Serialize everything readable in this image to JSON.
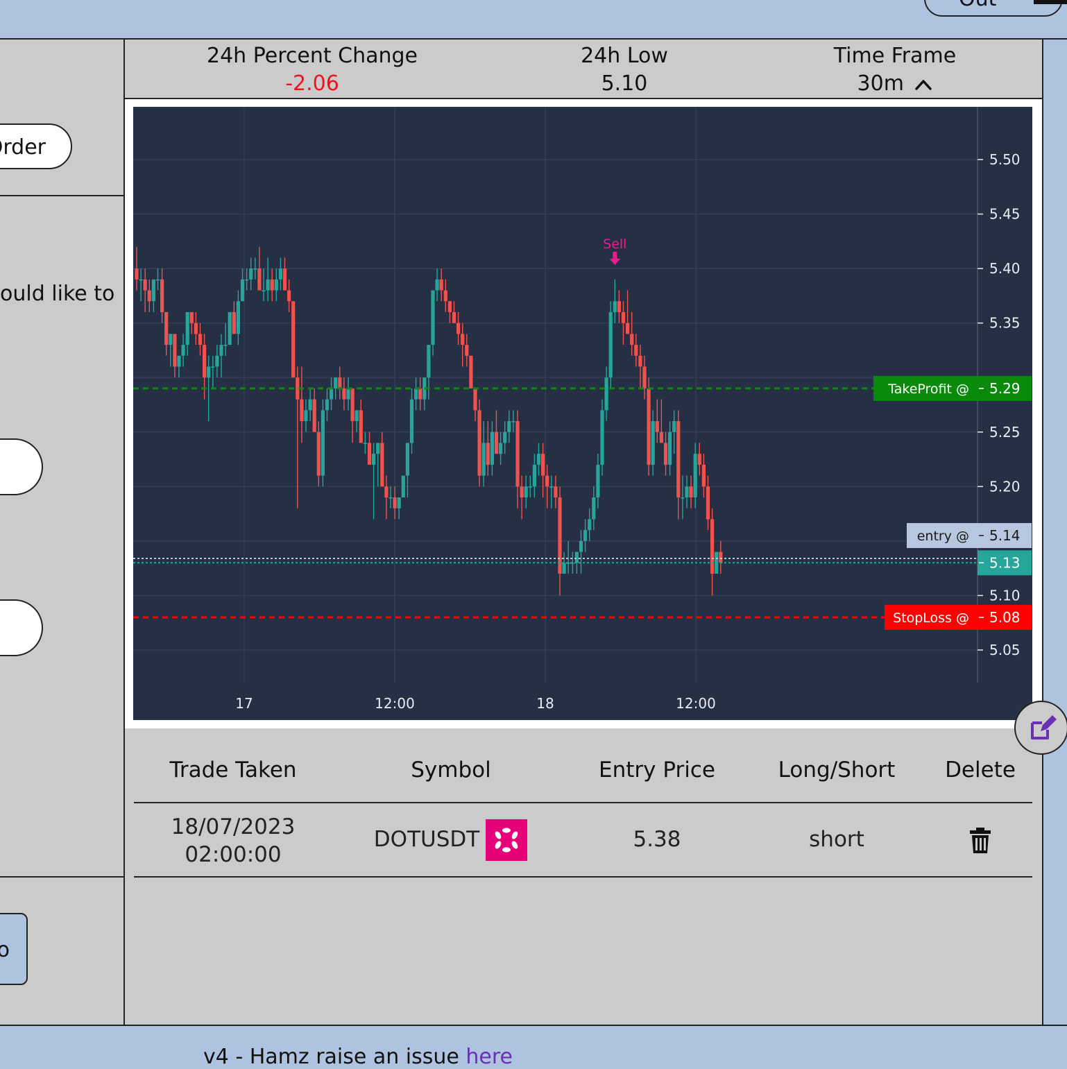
{
  "topbar": {
    "logout_label": "Out"
  },
  "left": {
    "order_label": "Order",
    "prompt_text": "ould like to",
    "bottom_button_label": "o"
  },
  "stats": {
    "percent_change_label": "24h Percent Change",
    "percent_change_value": "-2.06",
    "low_label": "24h Low",
    "low_value": "5.10",
    "timeframe_label": "Time Frame",
    "timeframe_value": "30m",
    "negative_color": "#f0141e"
  },
  "chart_data": {
    "type": "candlestick",
    "x_ticks": [
      "17",
      "12:00",
      "18",
      "12:00"
    ],
    "y_ticks": [
      "5.50",
      "5.45",
      "5.40",
      "5.35",
      "5.25",
      "5.20",
      "5.10",
      "5.05"
    ],
    "ylim": [
      5.03,
      5.55
    ],
    "grid": true,
    "up_color": "#26a69a",
    "down_color": "#ef5350",
    "markers": [
      {
        "label": "Sell",
        "color": "#e91e8c",
        "candle_index": 113
      }
    ],
    "price_lines": [
      {
        "label": "TakeProfit @",
        "value": "5.29",
        "color": "#0a8a0a"
      },
      {
        "label": "entry @",
        "value": "5.14",
        "color": "#b8c7e0"
      },
      {
        "label": "",
        "value": "5.13",
        "color": "#26a69a"
      },
      {
        "label": "StopLoss @",
        "value": "5.08",
        "color": "#ff0000"
      }
    ],
    "last_price": 5.13,
    "candles": [
      [
        5.4,
        5.42,
        5.38,
        5.39
      ],
      [
        5.39,
        5.4,
        5.37,
        5.39
      ],
      [
        5.39,
        5.4,
        5.36,
        5.38
      ],
      [
        5.38,
        5.39,
        5.36,
        5.37
      ],
      [
        5.37,
        5.39,
        5.36,
        5.39
      ],
      [
        5.39,
        5.4,
        5.38,
        5.39
      ],
      [
        5.39,
        5.4,
        5.35,
        5.36
      ],
      [
        5.36,
        5.36,
        5.32,
        5.33
      ],
      [
        5.33,
        5.34,
        5.31,
        5.34
      ],
      [
        5.34,
        5.34,
        5.3,
        5.31
      ],
      [
        5.31,
        5.32,
        5.3,
        5.32
      ],
      [
        5.32,
        5.34,
        5.31,
        5.33
      ],
      [
        5.33,
        5.36,
        5.32,
        5.36
      ],
      [
        5.36,
        5.36,
        5.34,
        5.35
      ],
      [
        5.35,
        5.36,
        5.33,
        5.34
      ],
      [
        5.34,
        5.35,
        5.32,
        5.33
      ],
      [
        5.33,
        5.34,
        5.28,
        5.3
      ],
      [
        5.3,
        5.32,
        5.26,
        5.31
      ],
      [
        5.31,
        5.32,
        5.29,
        5.31
      ],
      [
        5.31,
        5.33,
        5.3,
        5.32
      ],
      [
        5.32,
        5.34,
        5.3,
        5.33
      ],
      [
        5.33,
        5.35,
        5.32,
        5.33
      ],
      [
        5.33,
        5.36,
        5.33,
        5.36
      ],
      [
        5.36,
        5.37,
        5.34,
        5.34
      ],
      [
        5.34,
        5.38,
        5.33,
        5.37
      ],
      [
        5.37,
        5.4,
        5.37,
        5.39
      ],
      [
        5.39,
        5.4,
        5.38,
        5.39
      ],
      [
        5.39,
        5.41,
        5.38,
        5.4
      ],
      [
        5.4,
        5.41,
        5.39,
        5.4
      ],
      [
        5.4,
        5.42,
        5.38,
        5.38
      ],
      [
        5.38,
        5.4,
        5.37,
        5.38
      ],
      [
        5.38,
        5.41,
        5.37,
        5.39
      ],
      [
        5.39,
        5.4,
        5.37,
        5.38
      ],
      [
        5.38,
        5.4,
        5.37,
        5.39
      ],
      [
        5.39,
        5.41,
        5.38,
        5.4
      ],
      [
        5.4,
        5.41,
        5.38,
        5.38
      ],
      [
        5.38,
        5.39,
        5.36,
        5.37
      ],
      [
        5.37,
        5.37,
        5.3,
        5.3
      ],
      [
        5.3,
        5.31,
        5.18,
        5.28
      ],
      [
        5.28,
        5.31,
        5.24,
        5.26
      ],
      [
        5.26,
        5.28,
        5.25,
        5.27
      ],
      [
        5.27,
        5.29,
        5.26,
        5.28
      ],
      [
        5.28,
        5.29,
        5.25,
        5.25
      ],
      [
        5.25,
        5.26,
        5.2,
        5.21
      ],
      [
        5.21,
        5.28,
        5.2,
        5.27
      ],
      [
        5.27,
        5.29,
        5.26,
        5.28
      ],
      [
        5.28,
        5.3,
        5.27,
        5.29
      ],
      [
        5.29,
        5.3,
        5.28,
        5.3
      ],
      [
        5.3,
        5.31,
        5.28,
        5.29
      ],
      [
        5.29,
        5.3,
        5.27,
        5.28
      ],
      [
        5.28,
        5.3,
        5.27,
        5.29
      ],
      [
        5.29,
        5.29,
        5.24,
        5.26
      ],
      [
        5.26,
        5.27,
        5.25,
        5.27
      ],
      [
        5.27,
        5.28,
        5.25,
        5.24
      ],
      [
        5.24,
        5.25,
        5.23,
        5.24
      ],
      [
        5.24,
        5.25,
        5.22,
        5.22
      ],
      [
        5.22,
        5.24,
        5.17,
        5.23
      ],
      [
        5.23,
        5.24,
        5.2,
        5.24
      ],
      [
        5.24,
        5.25,
        5.23,
        5.2
      ],
      [
        5.2,
        5.21,
        5.17,
        5.19
      ],
      [
        5.19,
        5.2,
        5.18,
        5.19
      ],
      [
        5.19,
        5.2,
        5.17,
        5.18
      ],
      [
        5.18,
        5.19,
        5.17,
        5.19
      ],
      [
        5.19,
        5.21,
        5.19,
        5.21
      ],
      [
        5.21,
        5.23,
        5.19,
        5.24
      ],
      [
        5.24,
        5.29,
        5.23,
        5.28
      ],
      [
        5.28,
        5.3,
        5.27,
        5.29
      ],
      [
        5.29,
        5.3,
        5.27,
        5.28
      ],
      [
        5.28,
        5.3,
        5.27,
        5.3
      ],
      [
        5.3,
        5.31,
        5.28,
        5.33
      ],
      [
        5.33,
        5.35,
        5.32,
        5.38
      ],
      [
        5.38,
        5.4,
        5.37,
        5.39
      ],
      [
        5.39,
        5.4,
        5.37,
        5.38
      ],
      [
        5.38,
        5.39,
        5.36,
        5.37
      ],
      [
        5.37,
        5.37,
        5.35,
        5.36
      ],
      [
        5.36,
        5.37,
        5.35,
        5.35
      ],
      [
        5.35,
        5.36,
        5.33,
        5.34
      ],
      [
        5.34,
        5.35,
        5.31,
        5.33
      ],
      [
        5.33,
        5.34,
        5.31,
        5.32
      ],
      [
        5.32,
        5.32,
        5.29,
        5.29
      ],
      [
        5.29,
        5.29,
        5.26,
        5.27
      ],
      [
        5.27,
        5.28,
        5.2,
        5.21
      ],
      [
        5.21,
        5.26,
        5.2,
        5.24
      ],
      [
        5.24,
        5.26,
        5.21,
        5.22
      ],
      [
        5.22,
        5.26,
        5.21,
        5.25
      ],
      [
        5.25,
        5.27,
        5.23,
        5.23
      ],
      [
        5.23,
        5.25,
        5.22,
        5.24
      ],
      [
        5.24,
        5.26,
        5.23,
        5.25
      ],
      [
        5.25,
        5.27,
        5.24,
        5.26
      ],
      [
        5.26,
        5.27,
        5.25,
        5.26
      ],
      [
        5.26,
        5.27,
        5.18,
        5.2
      ],
      [
        5.2,
        5.21,
        5.17,
        5.19
      ],
      [
        5.19,
        5.21,
        5.18,
        5.2
      ],
      [
        5.2,
        5.21,
        5.19,
        5.2
      ],
      [
        5.2,
        5.23,
        5.19,
        5.22
      ],
      [
        5.22,
        5.24,
        5.21,
        5.23
      ],
      [
        5.23,
        5.24,
        5.19,
        5.21
      ],
      [
        5.21,
        5.22,
        5.18,
        5.2
      ],
      [
        5.2,
        5.21,
        5.18,
        5.2
      ],
      [
        5.2,
        5.21,
        5.18,
        5.19
      ],
      [
        5.19,
        5.2,
        5.1,
        5.12
      ],
      [
        5.12,
        5.14,
        5.12,
        5.13
      ],
      [
        5.13,
        5.15,
        5.12,
        5.13
      ],
      [
        5.13,
        5.14,
        5.12,
        5.13
      ],
      [
        5.13,
        5.14,
        5.12,
        5.14
      ],
      [
        5.14,
        5.16,
        5.12,
        5.15
      ],
      [
        5.15,
        5.17,
        5.14,
        5.16
      ],
      [
        5.16,
        5.18,
        5.15,
        5.17
      ],
      [
        5.17,
        5.2,
        5.16,
        5.19
      ],
      [
        5.19,
        5.23,
        5.18,
        5.22
      ],
      [
        5.22,
        5.28,
        5.21,
        5.27
      ],
      [
        5.27,
        5.31,
        5.26,
        5.3
      ],
      [
        5.3,
        5.37,
        5.29,
        5.36
      ],
      [
        5.36,
        5.39,
        5.35,
        5.37
      ],
      [
        5.37,
        5.38,
        5.35,
        5.36
      ],
      [
        5.36,
        5.37,
        5.33,
        5.35
      ],
      [
        5.35,
        5.38,
        5.34,
        5.34
      ],
      [
        5.34,
        5.36,
        5.32,
        5.33
      ],
      [
        5.33,
        5.34,
        5.31,
        5.32
      ],
      [
        5.32,
        5.33,
        5.29,
        5.31
      ],
      [
        5.31,
        5.32,
        5.28,
        5.29
      ],
      [
        5.29,
        5.3,
        5.21,
        5.22
      ],
      [
        5.22,
        5.27,
        5.21,
        5.26
      ],
      [
        5.26,
        5.28,
        5.24,
        5.25
      ],
      [
        5.25,
        5.28,
        5.24,
        5.24
      ],
      [
        5.24,
        5.25,
        5.21,
        5.22
      ],
      [
        5.22,
        5.26,
        5.21,
        5.25
      ],
      [
        5.25,
        5.27,
        5.23,
        5.26
      ],
      [
        5.26,
        5.27,
        5.17,
        5.19
      ],
      [
        5.19,
        5.21,
        5.17,
        5.19
      ],
      [
        5.19,
        5.21,
        5.18,
        5.2
      ],
      [
        5.2,
        5.21,
        5.18,
        5.19
      ],
      [
        5.19,
        5.24,
        5.18,
        5.23
      ],
      [
        5.23,
        5.24,
        5.21,
        5.22
      ],
      [
        5.22,
        5.23,
        5.19,
        5.2
      ],
      [
        5.2,
        5.21,
        5.16,
        5.17
      ],
      [
        5.17,
        5.18,
        5.1,
        5.12
      ],
      [
        5.12,
        5.14,
        5.12,
        5.14
      ],
      [
        5.14,
        5.15,
        5.12,
        5.13
      ]
    ]
  },
  "table": {
    "headers": [
      "Trade Taken",
      "Symbol",
      "Entry Price",
      "Long/Short",
      "Delete"
    ],
    "rows": [
      {
        "date": "18/07/2023",
        "time": "02:00:00",
        "symbol": "DOTUSDT",
        "entry_price": "5.38",
        "side": "short"
      }
    ],
    "symbol_logo_color": "#e6007a"
  },
  "footer": {
    "text": "v4 - Hamz raise an issue ",
    "link_text": "here"
  }
}
